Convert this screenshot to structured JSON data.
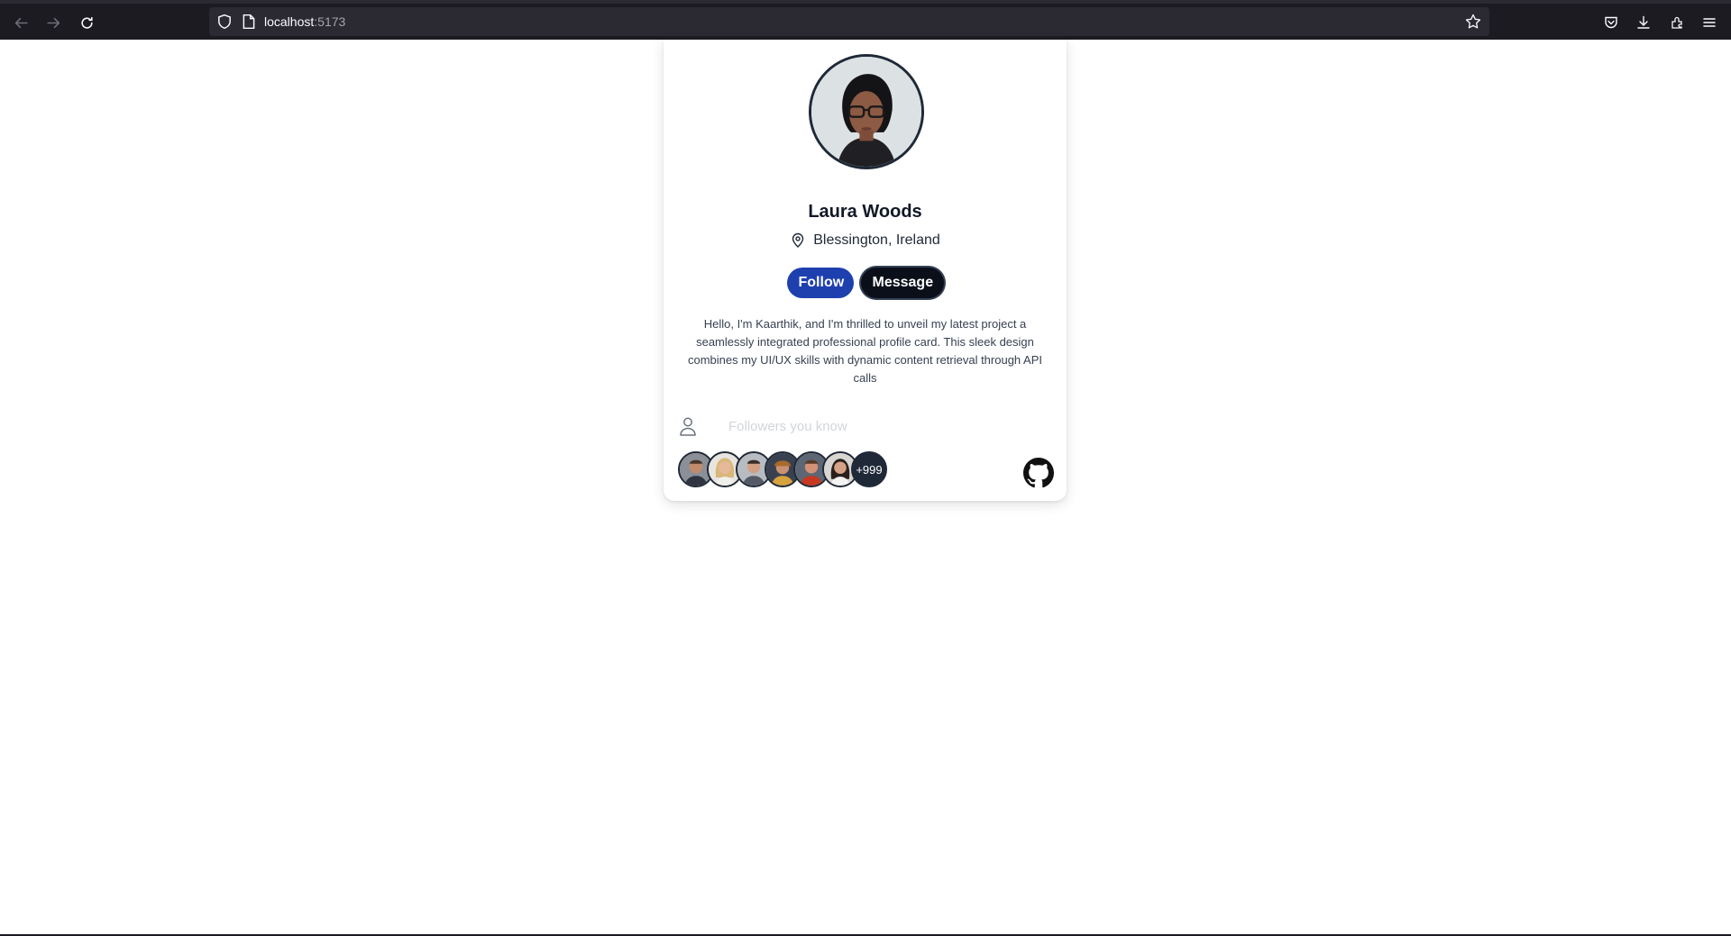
{
  "browser": {
    "url_host": "localhost",
    "url_port": ":5173"
  },
  "profile": {
    "name": "Laura Woods",
    "location": "Blessington, Ireland",
    "follow_label": "Follow",
    "message_label": "Message",
    "bio": "Hello, I'm Kaarthik, and I'm thrilled to unveil my latest project a seamlessly integrated professional profile card. This sleek design combines my UI/UX skills with dynamic content retrieval through API calls",
    "followers_label": "Followers you know",
    "followers_more": "+999"
  },
  "colors": {
    "follow_button": "#1e40af",
    "message_button": "#0b0f1a",
    "browser_chrome": "#1c1b22"
  },
  "icons": [
    "back-arrow-icon",
    "forward-arrow-icon",
    "reload-icon",
    "shield-icon",
    "page-icon",
    "star-icon",
    "pocket-icon",
    "download-icon",
    "extensions-icon",
    "menu-icon",
    "location-pin-icon",
    "user-icon",
    "github-icon"
  ]
}
